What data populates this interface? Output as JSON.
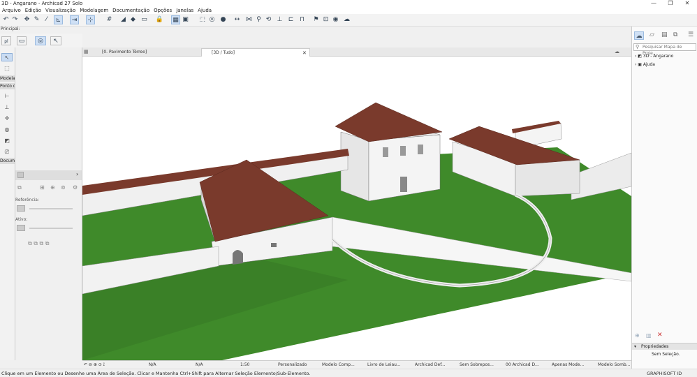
{
  "window": {
    "title": "3D - Angarano - Archicad 27 Solo"
  },
  "menu": [
    "Arquivo",
    "Edição",
    "Visualização",
    "Modelagem",
    "Documentação",
    "Opções",
    "Janelas",
    "Ajuda"
  ],
  "principal_label": "Principal:",
  "toolbox": {
    "label_modelagem": "Modelag",
    "label_ponto": "Ponto d",
    "label_document": "Docume"
  },
  "infopanel": {
    "referencia_label": "Referência:",
    "ativo_label": "Ativo:"
  },
  "tabs": [
    {
      "label": "[0. Pavimento Térreo]"
    },
    {
      "label": "[3D / Tudo]"
    }
  ],
  "status": {
    "na1": "N/A",
    "na2": "N/A",
    "scale": "1:50",
    "items": [
      "Personalizado",
      "Modelo Comp...",
      "Livro de Leiau...",
      "Archicad Def...",
      "Sem Sobrepos...",
      "00 Archicad D...",
      "Apenas Mode...",
      "Modelo Somb..."
    ]
  },
  "hint": "Clique em um Elemento ou Desenhe uma Área de Seleção. Clicar e Mantenha Ctrl+Shift para Alternar Seleção Elemento/Sub-Elemento.",
  "navigator": {
    "search_placeholder": "Pesquisar Mapa de Proje...",
    "items": [
      {
        "label": "3D - Angarano"
      },
      {
        "label": "Ajuda"
      }
    ]
  },
  "properties": {
    "header": "Propriedades",
    "value": "Sem Seleção."
  },
  "brand": "GRAPHISOFT ID",
  "colors": {
    "roof": "#7a3a2c",
    "grass": "#3f8a2a",
    "wall": "#f2f2f2",
    "accent": "#c9dcf3"
  }
}
